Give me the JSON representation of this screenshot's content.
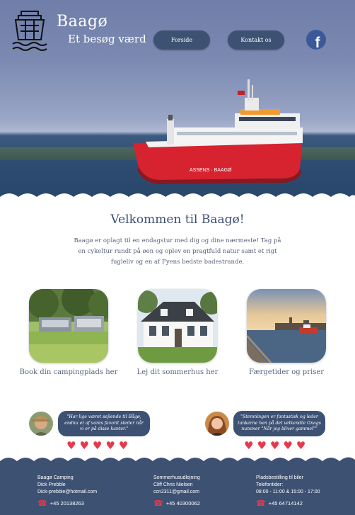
{
  "header": {
    "title": "Baagø",
    "subtitle": "Et besøg værd",
    "logo_icon": "ferry-logo-icon",
    "nav": [
      {
        "label": "Forside"
      },
      {
        "label": "Kontakt os"
      }
    ],
    "facebook_icon": "facebook-icon",
    "facebook_glyph": "f"
  },
  "hero": {
    "boat_text": "ASSENS · BAAGØ"
  },
  "welcome": {
    "title": "Velkommen til Baagø!",
    "text": "Baagø er oplagt til en endagstur med dig og dine nærmeste! Tag på en cykeltur rundt på øen og oplev en pragtfuld natur samt et rigt fugleliv og en af Fyens bedste badestrande."
  },
  "cards": [
    {
      "caption": "Book din campingplads her"
    },
    {
      "caption": "Lej dit sommerhus her"
    },
    {
      "caption": "Færgetider og priser"
    }
  ],
  "reviews": [
    {
      "quote": "\"Har lige været sejlende til Bågø, endnu et af vores favorit steder når vi er på disse kanter.\"",
      "stars": "♥♥♥♥♥"
    },
    {
      "quote": "\"Stemningen er fantastisk og leder tankerne hen på det velkendte Gnags nummer \"Når jeg bliver gammel\"\"",
      "stars": "♥♥♥♥♥"
    }
  ],
  "footer": {
    "columns": [
      {
        "lines": [
          "Baagø Camping",
          "Dick Prebble",
          "Dick-prebble@hotmail.com"
        ],
        "phone": "+45 20138263"
      },
      {
        "lines": [
          "Sommerhusudlejning",
          "Cliff Chris Nielsen",
          "ccn2311@gmail.com"
        ],
        "phone": "+45 40300062"
      },
      {
        "lines": [
          "Pladsbestilling til biler",
          "Telefontider:",
          "08:00 - 11:00 & 15:00 - 17:00"
        ],
        "phone": "+45 64714142"
      }
    ],
    "phone_icon": "☎"
  },
  "colors": {
    "navy": "#3d5173",
    "heart": "#e53a4e",
    "boat_red": "#d6232f"
  }
}
